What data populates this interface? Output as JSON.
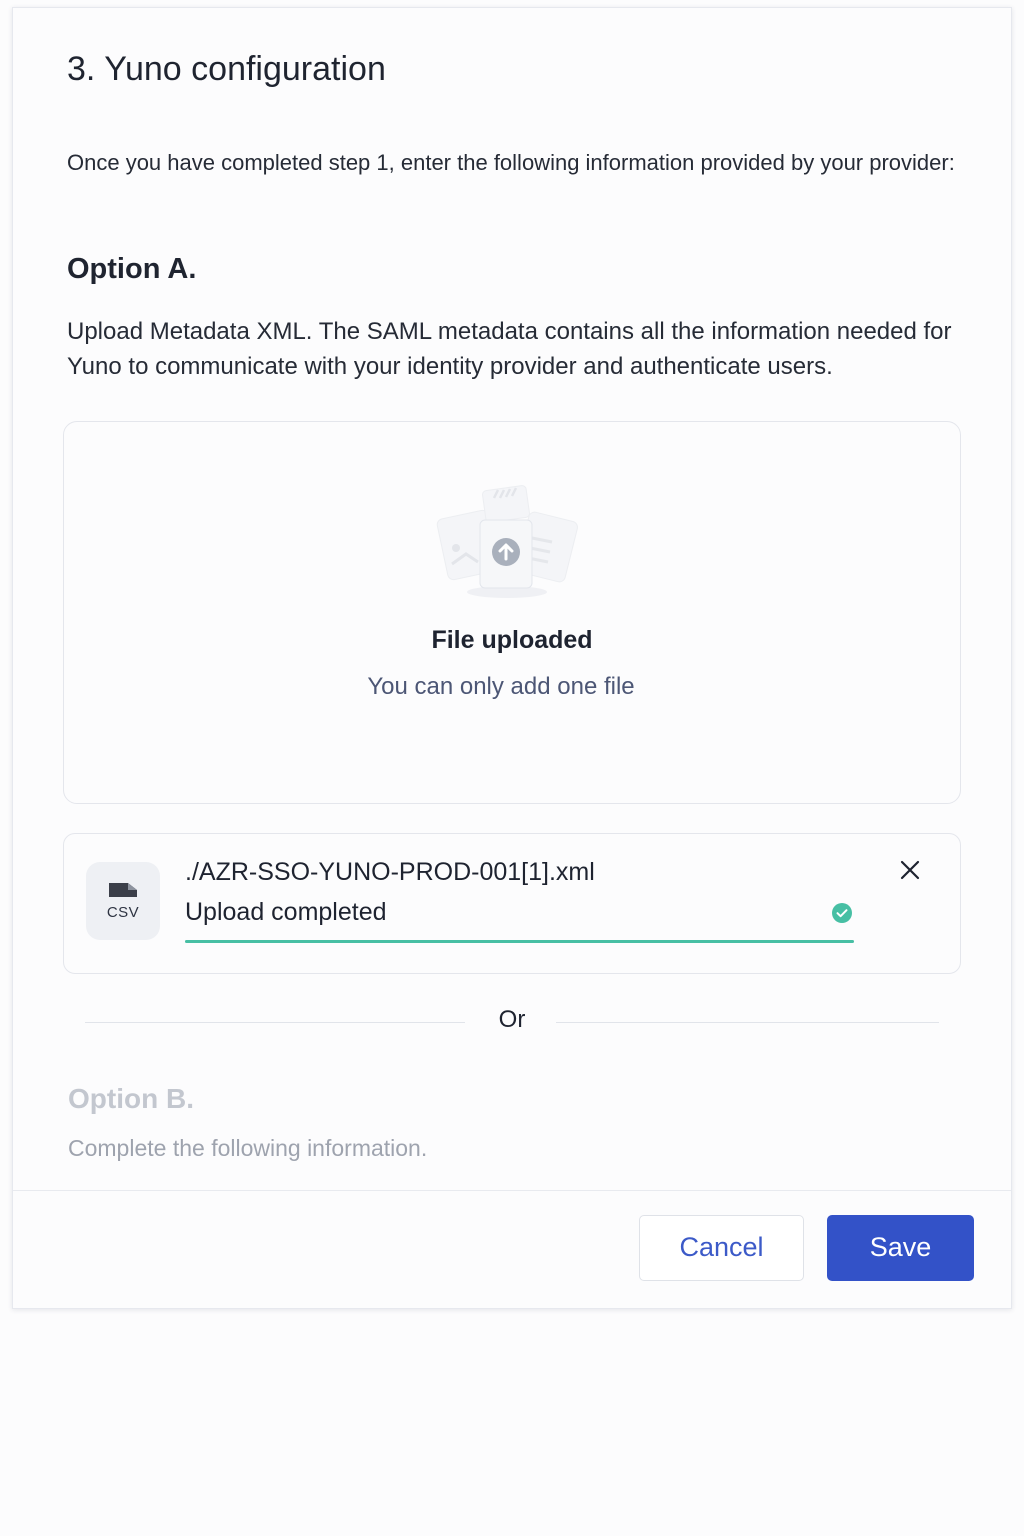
{
  "dialog": {
    "title": "3. Yuno configuration",
    "intro": "Once you have completed step 1, enter the following information provided by your provider:"
  },
  "option_a": {
    "title": "Option A.",
    "description": "Upload Metadata XML. The SAML metadata contains all the information needed for Yuno to communicate with your identity provider and authenticate users.",
    "dropzone": {
      "title": "File uploaded",
      "subtitle": "You can only add one file"
    },
    "file": {
      "type_label": "CSV",
      "name": "./AZR-SSO-YUNO-PROD-001[1].xml",
      "status": "Upload completed",
      "progress": 1.0
    }
  },
  "divider": {
    "label": "Or"
  },
  "option_b": {
    "title": "Option B.",
    "description": "Complete the following information."
  },
  "footer": {
    "cancel_label": "Cancel",
    "save_label": "Save"
  },
  "colors": {
    "primary": "#3352c8",
    "success": "#47bfa4",
    "muted": "#9ea3ae"
  }
}
